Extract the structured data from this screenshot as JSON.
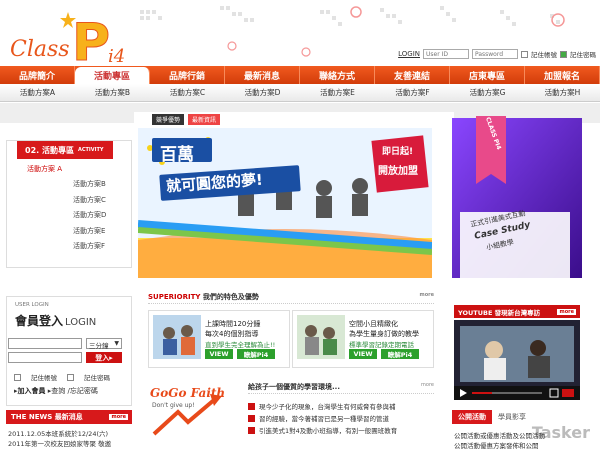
{
  "brand": {
    "logo_text": "Class Pi4",
    "accent": "#e8561b",
    "red": "#d7191b"
  },
  "login": {
    "login_label": "LOGIN",
    "user_placeholder": "User ID",
    "pass_placeholder": "Password",
    "remember_account": "記住帳號",
    "remember_password": "記住密碼"
  },
  "nav": [
    "品牌簡介",
    "活動專區",
    "品牌行銷",
    "最新消息",
    "聯絡方式",
    "友善連結",
    "店東專區",
    "加盟報名"
  ],
  "nav_active": 1,
  "subnav": [
    "活動方案A",
    "活動方案B",
    "活動方案C",
    "活動方案D",
    "活動方案E",
    "活動方案F",
    "活動方案G",
    "活動方案H"
  ],
  "activity": {
    "title": "02. 活動專區",
    "title_en": "ACTIVITY",
    "current": "活動方案 A",
    "items": [
      "活動方案B",
      "活動方案C",
      "活動方案D",
      "活動方案E",
      "活動方案F"
    ]
  },
  "banner": {
    "tab1": "競爭優勢",
    "tab2": "最新資訊",
    "headline1": "百萬",
    "headline2": "就可圓您的夢!",
    "now": "即日起!",
    "open": "開放加盟"
  },
  "promo": {
    "ribbon": "CLASS PI4",
    "case1": "正式引進美式互動",
    "case2": "Case Study",
    "case3": "小組教學"
  },
  "member": {
    "small": "USER LOGIN",
    "title": "會員登入",
    "title_en": "LOGIN",
    "select_value": "三分鐘",
    "go": "登入",
    "remember_account": "記住帳號",
    "remember_password": "記住密碼",
    "join": "加入會員",
    "query": "查詢",
    "forgot": "忘記密碼"
  },
  "news": {
    "title_en": "THE NEWS",
    "title": "最新消息",
    "more": "more",
    "items": [
      "2011.12.05本班系統於12/24(六)",
      "2011年第一次校友回娘家等聚 敬邀"
    ]
  },
  "superiority": {
    "label_en": "SUPERIORITY",
    "label": "我們的特色及優勢",
    "more": "more",
    "cards": [
      {
        "t1": "上課時間120分鐘",
        "t2": "每次4的個別指導",
        "t3": "直到學生完全理解為止!!",
        "view": "VIEW",
        "cta": "瞭解Pi4"
      },
      {
        "t1": "空間小且精緻化",
        "t2": "為學生量身訂做的教學",
        "t3": "標準學習記錄定期電話",
        "view": "VIEW",
        "cta": "瞭解Pi4"
      }
    ]
  },
  "gogo": {
    "title": "GoGo Faith",
    "sub": "Don't give up!"
  },
  "learn": {
    "title": "給孩子一個優質的學習環境...",
    "more": "more",
    "items": [
      "現今少子化的現象，台灣學生有何威脅有參與補",
      "習的經驗，當今著補習已是另一種學習的管道",
      "引進美式1對4及動小班指導，有別一般團班教育"
    ]
  },
  "youtube": {
    "title": "YOUTUBE  發現新台灣專訪",
    "more": "more"
  },
  "notice": {
    "title": "公開活動",
    "title2": "學員影享",
    "items": [
      "公開活動或優惠活動及公開活動",
      "公開活動優惠方案發佈和公開"
    ]
  },
  "watermark": "Tasker"
}
